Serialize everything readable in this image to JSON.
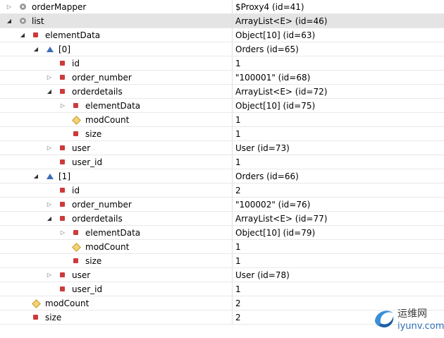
{
  "rows": [
    {
      "depth": 0,
      "toggle": "collapsed",
      "icon": "interface",
      "name": "orderMapper",
      "value": "$Proxy4  (id=41)"
    },
    {
      "depth": 0,
      "toggle": "expanded",
      "icon": "interface",
      "name": "list",
      "value": "ArrayList<E>  (id=46)",
      "selected": true
    },
    {
      "depth": 1,
      "toggle": "expanded",
      "icon": "field",
      "name": "elementData",
      "value": "Object[10]  (id=63)"
    },
    {
      "depth": 2,
      "toggle": "expanded",
      "icon": "element",
      "name": "[0]",
      "value": "Orders  (id=65)"
    },
    {
      "depth": 3,
      "toggle": "none",
      "icon": "field",
      "name": "id",
      "value": "1"
    },
    {
      "depth": 3,
      "toggle": "collapsed",
      "icon": "field",
      "name": "order_number",
      "value": "\"100001\" (id=68)"
    },
    {
      "depth": 3,
      "toggle": "expanded",
      "icon": "field",
      "name": "orderdetails",
      "value": "ArrayList<E>  (id=72)"
    },
    {
      "depth": 4,
      "toggle": "collapsed",
      "icon": "field",
      "name": "elementData",
      "value": "Object[10]  (id=75)"
    },
    {
      "depth": 4,
      "toggle": "none",
      "icon": "default",
      "name": "modCount",
      "value": "1"
    },
    {
      "depth": 4,
      "toggle": "none",
      "icon": "field",
      "name": "size",
      "value": "1"
    },
    {
      "depth": 3,
      "toggle": "collapsed",
      "icon": "field",
      "name": "user",
      "value": "User  (id=73)"
    },
    {
      "depth": 3,
      "toggle": "none",
      "icon": "field",
      "name": "user_id",
      "value": "1"
    },
    {
      "depth": 2,
      "toggle": "expanded",
      "icon": "element",
      "name": "[1]",
      "value": "Orders  (id=66)"
    },
    {
      "depth": 3,
      "toggle": "none",
      "icon": "field",
      "name": "id",
      "value": "2"
    },
    {
      "depth": 3,
      "toggle": "collapsed",
      "icon": "field",
      "name": "order_number",
      "value": "\"100002\" (id=76)"
    },
    {
      "depth": 3,
      "toggle": "expanded",
      "icon": "field",
      "name": "orderdetails",
      "value": "ArrayList<E>  (id=77)"
    },
    {
      "depth": 4,
      "toggle": "collapsed",
      "icon": "field",
      "name": "elementData",
      "value": "Object[10]  (id=79)"
    },
    {
      "depth": 4,
      "toggle": "none",
      "icon": "default",
      "name": "modCount",
      "value": "1"
    },
    {
      "depth": 4,
      "toggle": "none",
      "icon": "field",
      "name": "size",
      "value": "1"
    },
    {
      "depth": 3,
      "toggle": "collapsed",
      "icon": "field",
      "name": "user",
      "value": "User  (id=78)"
    },
    {
      "depth": 3,
      "toggle": "none",
      "icon": "field",
      "name": "user_id",
      "value": "1"
    },
    {
      "depth": 1,
      "toggle": "none",
      "icon": "default",
      "name": "modCount",
      "value": "2"
    },
    {
      "depth": 1,
      "toggle": "none",
      "icon": "private",
      "name": "size",
      "value": "2"
    }
  ],
  "icons": {
    "collapsed": "triangle-right-icon",
    "expanded": "triangle-down-icon",
    "interface": "interface-variable-icon",
    "field": "private-field-icon",
    "private": "private-field-icon",
    "default": "default-field-icon",
    "element": "array-element-icon"
  },
  "watermark": {
    "line1": "运维网",
    "line2": "iyunv.com"
  }
}
